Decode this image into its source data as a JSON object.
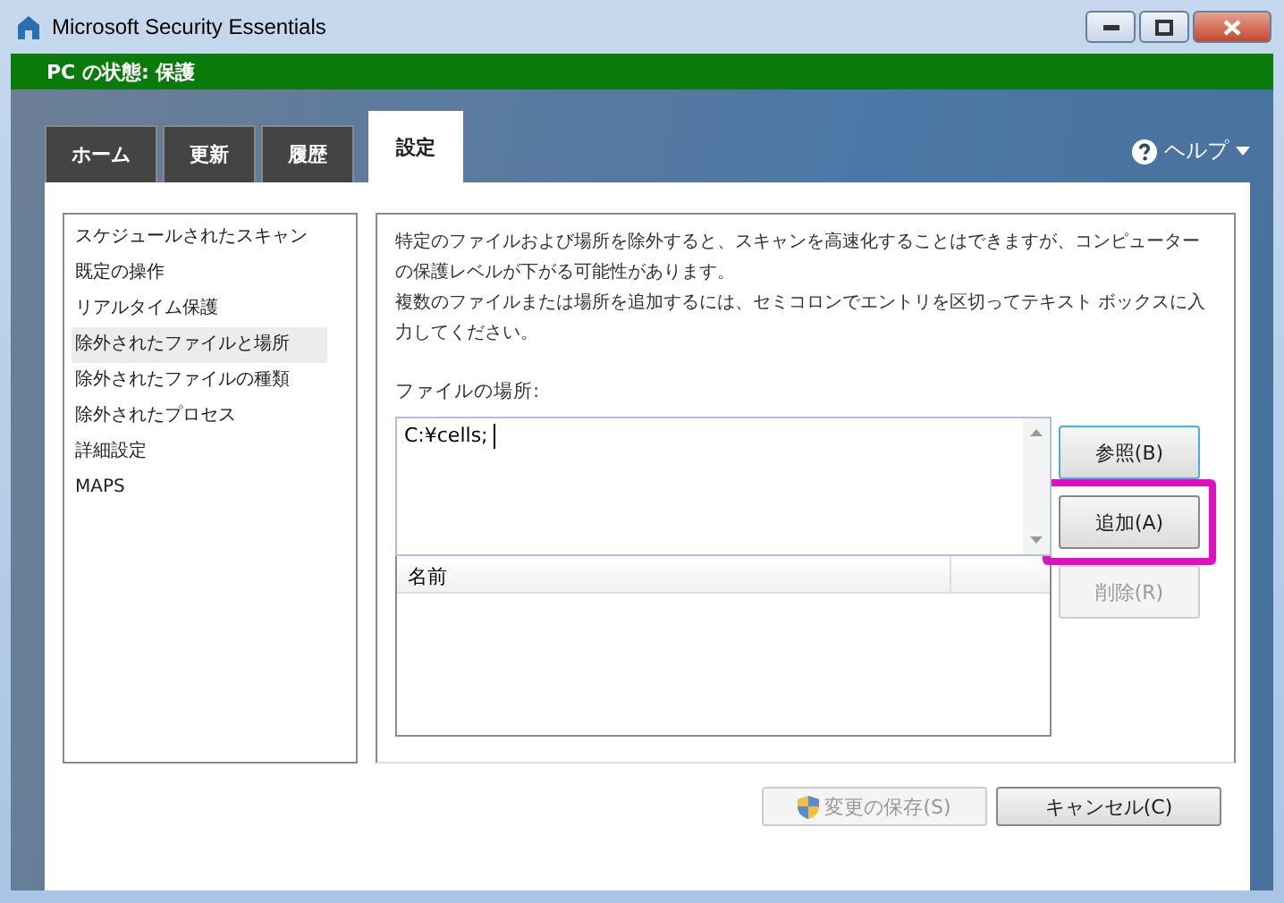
{
  "window": {
    "title": "Microsoft Security Essentials"
  },
  "status_bar": {
    "text": "PC の状態: 保護"
  },
  "tabs": [
    {
      "label": "ホーム",
      "selected": false
    },
    {
      "label": "更新",
      "selected": false
    },
    {
      "label": "履歴",
      "selected": false
    },
    {
      "label": "設定",
      "selected": true
    }
  ],
  "help": {
    "label": "ヘルプ"
  },
  "sidebar": {
    "items": [
      {
        "label": "スケジュールされたスキャン",
        "selected": false
      },
      {
        "label": "既定の操作",
        "selected": false
      },
      {
        "label": "リアルタイム保護",
        "selected": false
      },
      {
        "label": "除外されたファイルと場所",
        "selected": true
      },
      {
        "label": "除外されたファイルの種類",
        "selected": false
      },
      {
        "label": "除外されたプロセス",
        "selected": false
      },
      {
        "label": "詳細設定",
        "selected": false
      },
      {
        "label": "MAPS",
        "selected": false
      }
    ]
  },
  "description": [
    "特定のファイルおよび場所を除外すると、スキャンを高速化することはできますが、コンピューターの保護レベルが下がる可能性があります。",
    "複数のファイルまたは場所を追加するには、セミコロンでエントリを区切ってテキスト ボックスに入力してください。"
  ],
  "location_field": {
    "label": "ファイルの場所:",
    "value": "C:¥cells; "
  },
  "table": {
    "columns": [
      "名前"
    ]
  },
  "side_buttons": [
    {
      "label": "参照(B)",
      "disabled": false,
      "highlighted": false
    },
    {
      "label": "追加(A)",
      "disabled": false,
      "highlighted": true
    },
    {
      "label": "削除(R)",
      "disabled": true,
      "highlighted": false
    }
  ],
  "footer_buttons": [
    {
      "label": "変更の保存(S)",
      "disabled": true,
      "shield": true
    },
    {
      "label": "キャンセル(C)",
      "disabled": false,
      "shield": false
    }
  ]
}
